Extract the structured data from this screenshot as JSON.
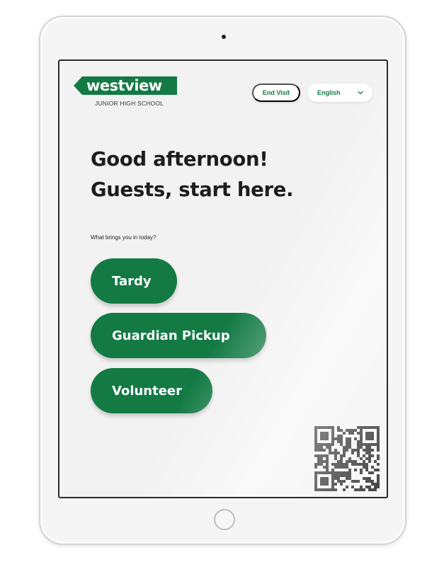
{
  "school": {
    "logo_text": "westview",
    "subtitle": "JUNIOR HIGH SCHOOL"
  },
  "header": {
    "end_visit_label": "End Visit",
    "language": {
      "selected": "English"
    }
  },
  "main": {
    "greeting_line1": "Good afternoon!",
    "greeting_line2": "Guests, start here.",
    "prompt": "What brings you in today?",
    "options": [
      {
        "label": "Tardy"
      },
      {
        "label": "Guardian Pickup"
      },
      {
        "label": "Volunteer"
      }
    ]
  },
  "colors": {
    "brand_green": "#137a44",
    "text_dark": "#1d1d1d",
    "screen_bg": "#f2f2f2"
  },
  "icons": {
    "language_dropdown": "chevron-down-icon",
    "qr": "qr-code-icon",
    "home": "home-button-icon"
  }
}
